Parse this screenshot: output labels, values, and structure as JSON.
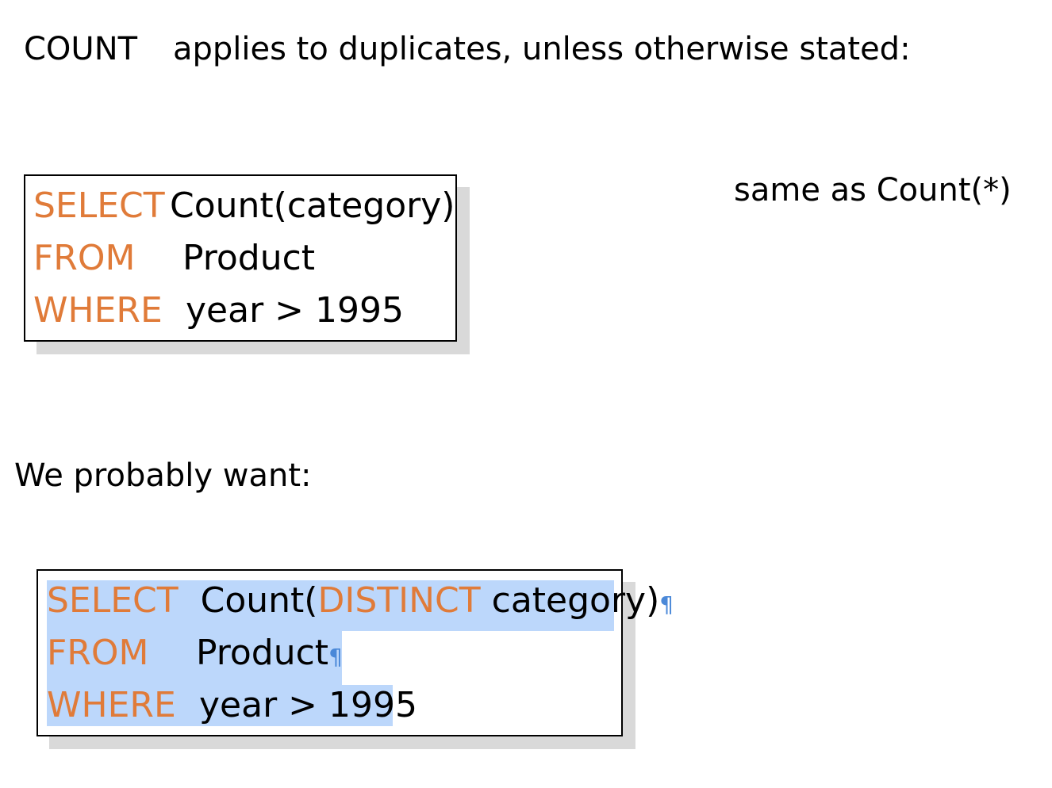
{
  "intro": {
    "keyword": "COUNT",
    "text": "applies to duplicates, unless otherwise stated:"
  },
  "note": "same as Count(*)",
  "query1": {
    "line1": {
      "keyword": "SELECT",
      "rest": "Count(category)"
    },
    "line2": {
      "keyword": "FROM",
      "rest": "Product"
    },
    "line3": {
      "keyword": "WHERE",
      "rest": "year > 1995"
    }
  },
  "transition": "We probably want:",
  "query2": {
    "line1": {
      "keyword": "SELECT",
      "open": "Count(",
      "distinct": "DISTINCT",
      "rest": " category)",
      "mark": "¶"
    },
    "line2": {
      "keyword": "FROM",
      "rest": "Product",
      "mark": "¶"
    },
    "line3": {
      "keyword": "WHERE",
      "rest": "year > 1995"
    }
  },
  "colors": {
    "keyword": "#e07b39",
    "selection": "#bcd7fb",
    "pilcrow": "#4a88d8",
    "shadow": "#d9d9d9"
  }
}
